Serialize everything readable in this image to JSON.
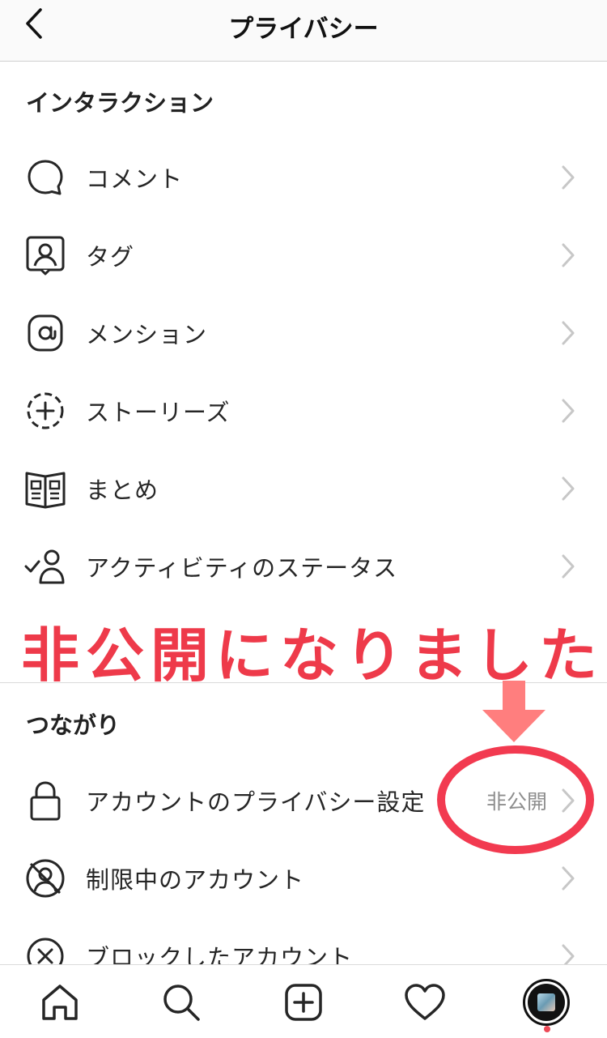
{
  "header": {
    "title": "プライバシー"
  },
  "sections": {
    "interaction": {
      "title": "インタラクション",
      "items": [
        {
          "label": "コメント",
          "icon": "comment-icon"
        },
        {
          "label": "タグ",
          "icon": "tag-person-icon"
        },
        {
          "label": "メンション",
          "icon": "at-sign-icon"
        },
        {
          "label": "ストーリーズ",
          "icon": "story-plus-icon"
        },
        {
          "label": "まとめ",
          "icon": "guide-book-icon"
        },
        {
          "label": "アクティビティのステータス",
          "icon": "activity-status-icon"
        }
      ]
    },
    "connections": {
      "title": "つながり",
      "items": [
        {
          "label": "アカウントのプライバシー設定",
          "value": "非公開",
          "icon": "lock-icon"
        },
        {
          "label": "制限中のアカウント",
          "icon": "restricted-icon"
        },
        {
          "label": "ブロックしたアカウント",
          "icon": "blocked-icon"
        }
      ]
    }
  },
  "annotation": {
    "text": "非公開になりました",
    "color": "#ee3a4a"
  },
  "tabbar": {
    "items": [
      "home-icon",
      "search-icon",
      "new-post-icon",
      "activity-heart-icon",
      "profile-avatar"
    ]
  },
  "colors": {
    "accent_red": "#ee3a4a",
    "notification_dot": "#ed4956",
    "chevron": "#c7c7c7"
  }
}
